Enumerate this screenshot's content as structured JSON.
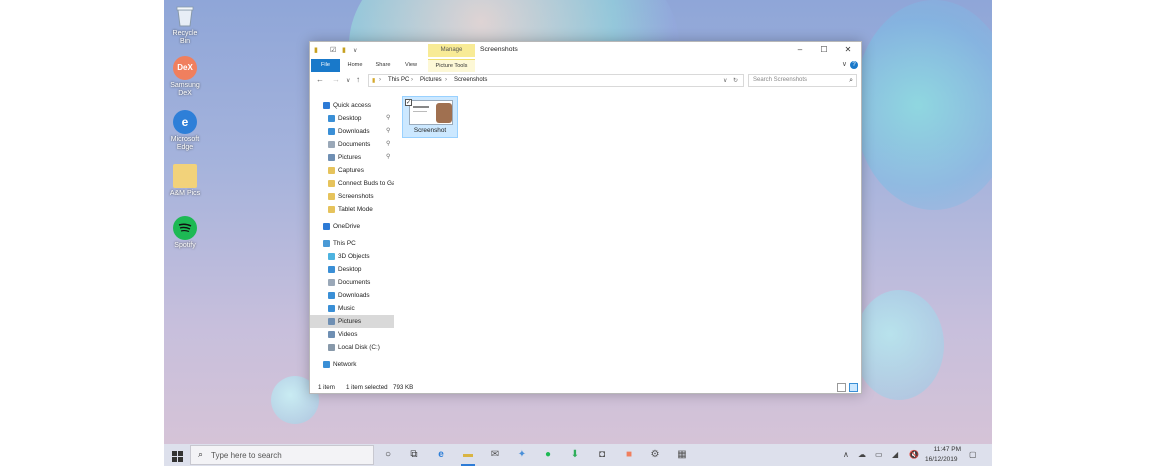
{
  "desktop": {
    "icons": [
      {
        "label": "Recycle Bin",
        "icon": "recycle-bin-icon"
      },
      {
        "label": "Samsung DeX",
        "icon": "samsung-dex-icon",
        "badge": "DeX"
      },
      {
        "label": "Microsoft Edge",
        "icon": "edge-icon"
      },
      {
        "label": "A&M Pics",
        "icon": "folder-icon"
      },
      {
        "label": "Spotify",
        "icon": "spotify-icon"
      }
    ]
  },
  "explorer": {
    "title": "Screenshots",
    "ribbon": {
      "contextual_group": "Manage",
      "tabs": [
        "File",
        "Home",
        "Share",
        "View",
        "Picture Tools"
      ]
    },
    "address": {
      "crumbs": [
        "This PC",
        "Pictures",
        "Screenshots"
      ]
    },
    "search": {
      "placeholder": "Search Screenshots"
    },
    "nav": {
      "quick_access": {
        "label": "Quick access",
        "items": [
          {
            "label": "Desktop",
            "pinned": true
          },
          {
            "label": "Downloads",
            "pinned": true
          },
          {
            "label": "Documents",
            "pinned": true
          },
          {
            "label": "Pictures",
            "pinned": true
          },
          {
            "label": "Captures",
            "pinned": false
          },
          {
            "label": "Connect Buds to Ga",
            "pinned": false
          },
          {
            "label": "Screenshots",
            "pinned": false
          },
          {
            "label": "Tablet Mode",
            "pinned": false
          }
        ]
      },
      "onedrive": {
        "label": "OneDrive"
      },
      "this_pc": {
        "label": "This PC",
        "items": [
          {
            "label": "3D Objects"
          },
          {
            "label": "Desktop"
          },
          {
            "label": "Documents"
          },
          {
            "label": "Downloads"
          },
          {
            "label": "Music"
          },
          {
            "label": "Pictures",
            "selected": true
          },
          {
            "label": "Videos"
          },
          {
            "label": "Local Disk (C:)"
          }
        ]
      },
      "network": {
        "label": "Network"
      }
    },
    "files": [
      {
        "name": "Screenshot",
        "selected": true
      }
    ],
    "status": {
      "count": "1 item",
      "selection": "1 item selected",
      "size": "793 KB"
    }
  },
  "taskbar": {
    "search_placeholder": "Type here to search",
    "time": "11:47 PM",
    "date": "16/12/2019"
  },
  "colors": {
    "accent": "#1979ca",
    "manage_tab": "#f8eb96",
    "selection": "#cce8ff"
  }
}
